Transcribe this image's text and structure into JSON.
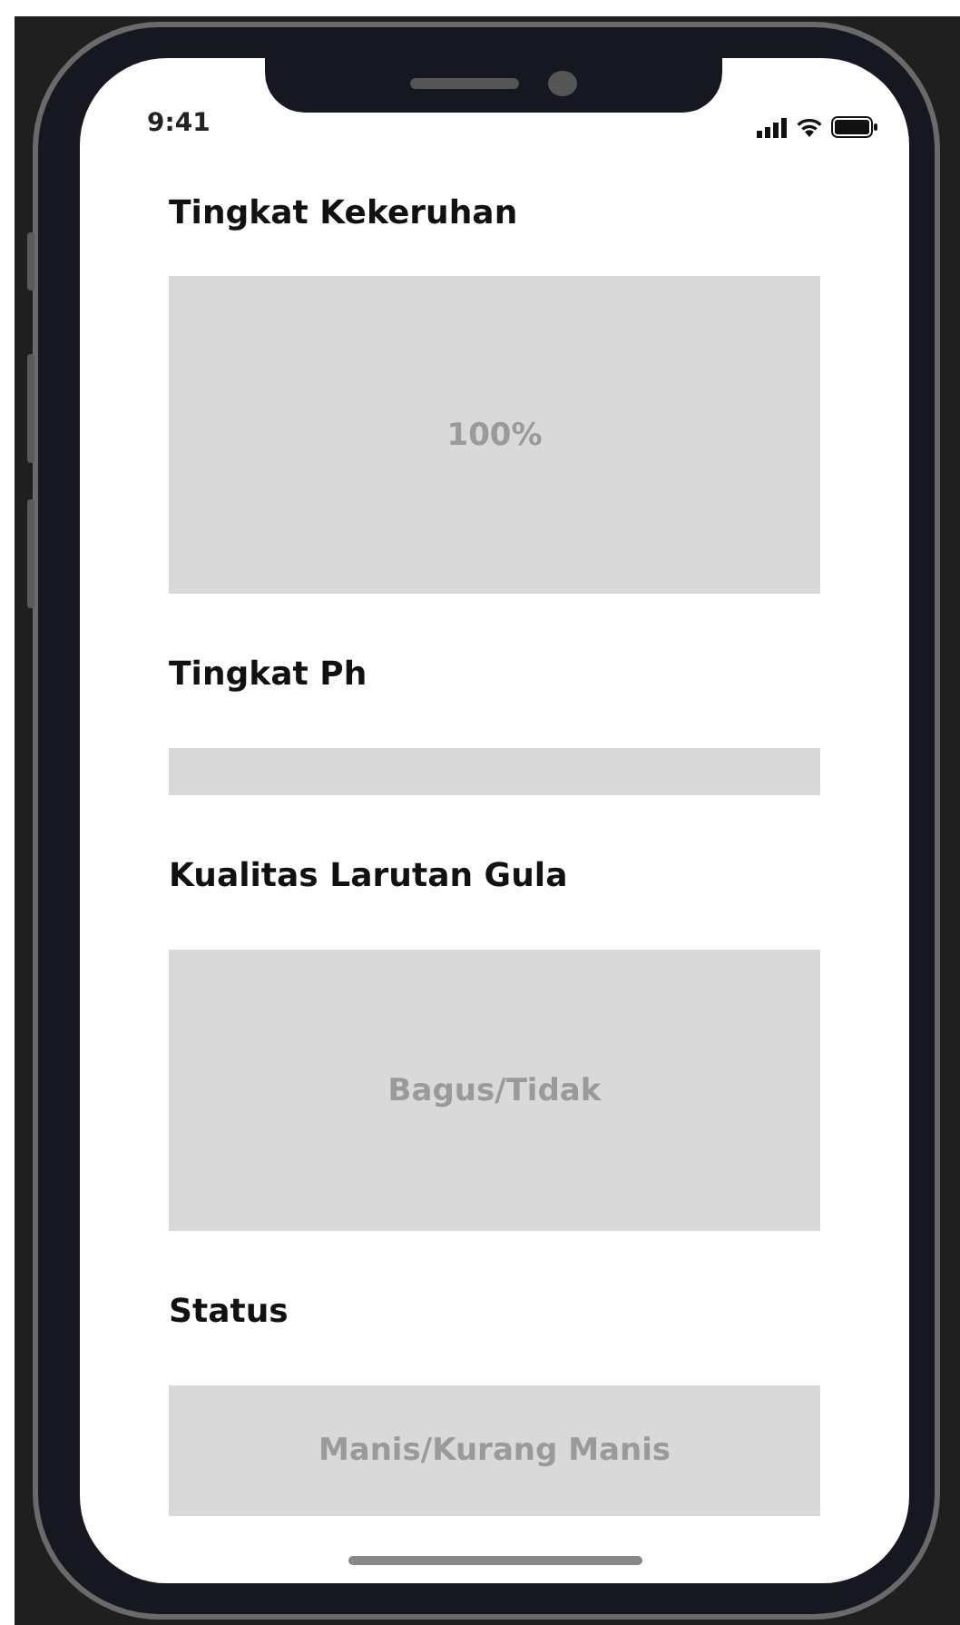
{
  "status_bar": {
    "time": "9:41"
  },
  "sections": [
    {
      "title": "Tingkat Kekeruhan",
      "value": "100%"
    },
    {
      "title": "Tingkat Ph"
    },
    {
      "title": "Kualitas Larutan Gula",
      "value": "Bagus/Tidak"
    },
    {
      "title": "Status",
      "value": "Manis/Kurang Manis"
    }
  ]
}
